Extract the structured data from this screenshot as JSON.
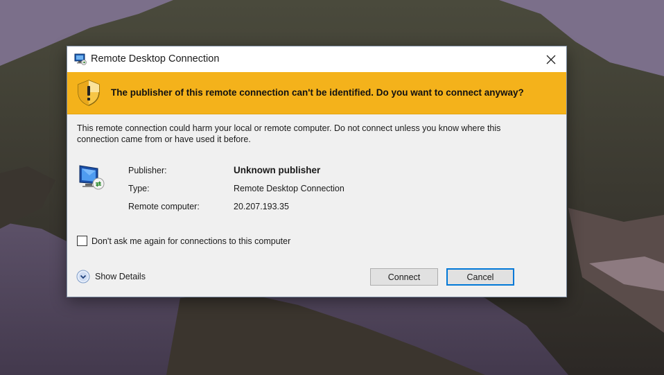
{
  "dialog": {
    "title": "Remote Desktop Connection",
    "banner_text": "The publisher of this remote connection can't be identified. Do you want to connect anyway?",
    "warning_text": "This remote connection could harm your local or remote computer. Do not connect unless you know where this connection came from or have used it before.",
    "details": [
      {
        "label": "Publisher:",
        "value": "Unknown publisher"
      },
      {
        "label": "Type:",
        "value": "Remote Desktop Connection"
      },
      {
        "label": "Remote computer:",
        "value": "20.207.193.35"
      }
    ],
    "checkbox_label": "Don't ask me again for connections to this computer",
    "checkbox_checked": false,
    "show_details_label": "Show Details",
    "connect_label": "Connect",
    "cancel_label": "Cancel"
  },
  "colors": {
    "banner": "#f4b21b",
    "focus_border": "#0078d7",
    "dialog_bg": "#f0f0f0"
  },
  "icons": {
    "title": "remote-desktop-icon",
    "banner": "shield-warning-icon",
    "details": "remote-computer-icon",
    "close": "close-icon",
    "expand": "chevron-down-circle-icon"
  }
}
